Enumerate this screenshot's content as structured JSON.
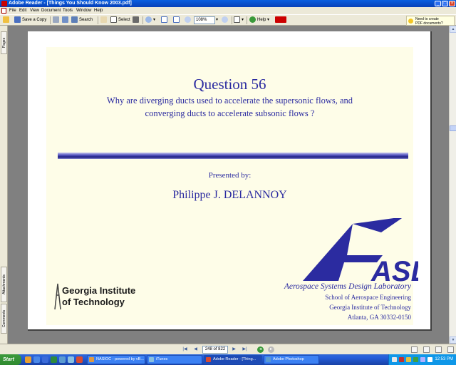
{
  "window": {
    "title": "Adobe Reader - [Things You Should Know 2003.pdf]"
  },
  "menu": [
    "File",
    "Edit",
    "View",
    "Document",
    "Tools",
    "Window",
    "Help"
  ],
  "toolbar": {
    "save_copy": "Save a Copy",
    "search": "Search",
    "select": "Select",
    "zoom": "108%",
    "help": "Help",
    "pdf_help_line1": "Need to create",
    "pdf_help_line2": "PDF documents?"
  },
  "side_tabs": [
    "Pages",
    "Attachments",
    "Comments"
  ],
  "slide": {
    "title": "Question 56",
    "question_line1": "Why are diverging ducts used to accelerate the supersonic flows, and",
    "question_line2": "converging ducts to accelerate subsonic flows ?",
    "presented_by": "Presented by:",
    "presenter": "Philippe J. DELANNOY",
    "logo_text": "ASDL",
    "lab_name": "Aerospace Systems Design Laboratory",
    "school": "School of Aerospace Engineering",
    "institute": "Georgia Institute of Technology",
    "city": "Atlanta, GA 30332-0150",
    "gt_logo_line1": "Georgia Institute",
    "gt_logo_line2": "of Technology"
  },
  "status": {
    "page_indicator": "248 of 822"
  },
  "taskbar": {
    "start": "Start",
    "tasks": [
      {
        "label": "NASIOC - powered by vB...",
        "active": false
      },
      {
        "label": "iTunes",
        "active": false
      },
      {
        "label": "Adobe Reader - [Thing...",
        "active": true
      },
      {
        "label": "Adobe Photoshop",
        "active": false
      }
    ],
    "clock": "12:53 PM"
  },
  "colors": {
    "slide_text": "#2b2ba0",
    "slide_background": "#fefde8",
    "titlebar": "#0a5fe0"
  }
}
